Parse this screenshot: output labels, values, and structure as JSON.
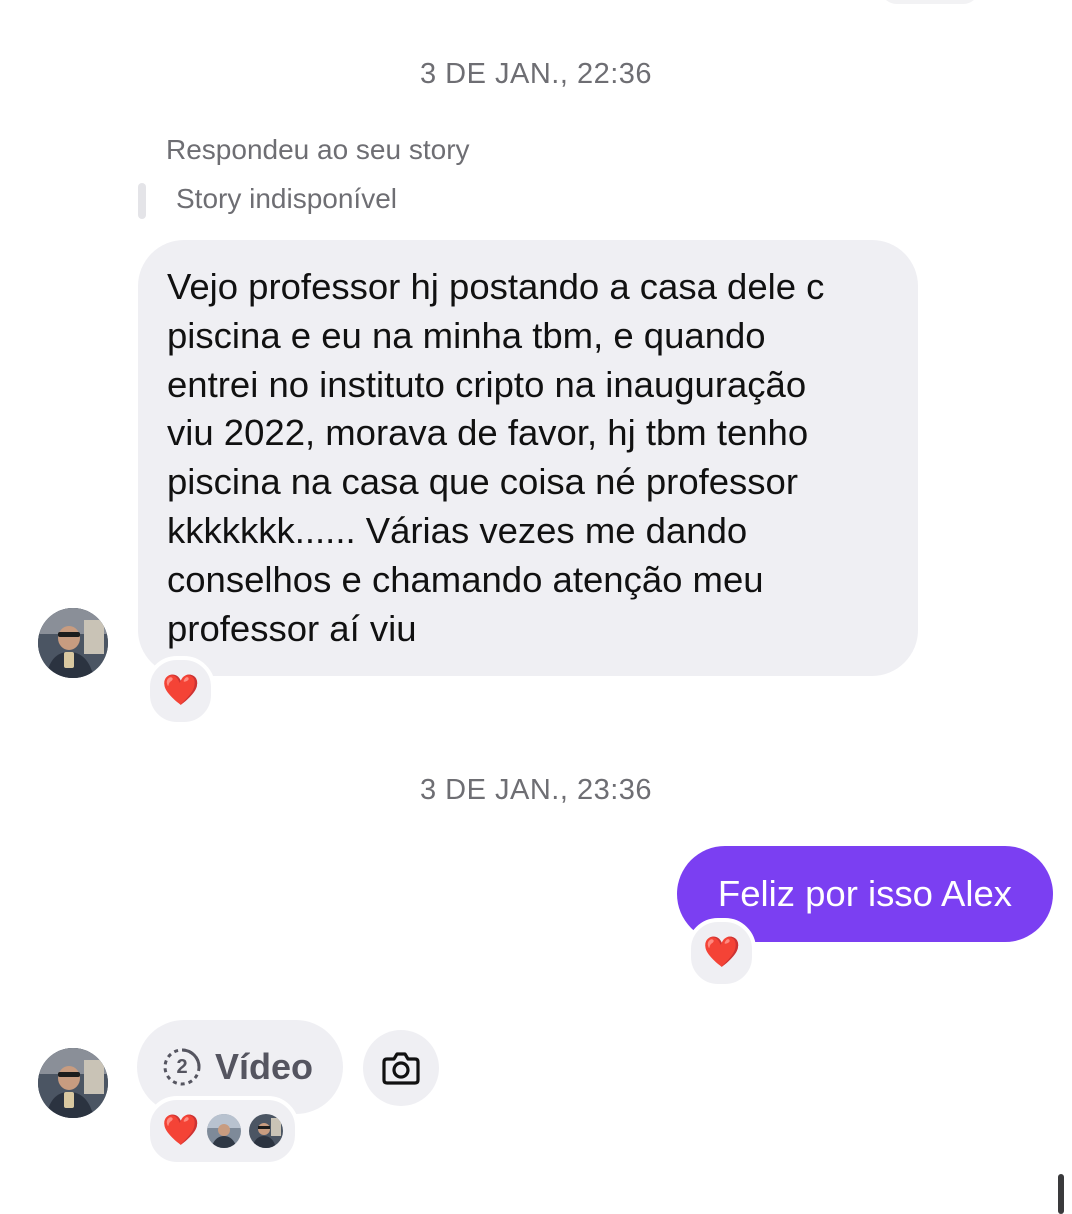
{
  "thread": {
    "timestamp_1": "3 DE JAN., 22:36",
    "story_reply": {
      "label": "Respondeu ao seu story",
      "unavailable": "Story indisponível"
    },
    "incoming_message": {
      "lines": [
        "Vejo professor hj postando a casa dele c",
        "piscina e eu na minha tbm, e quando",
        "entrei no instituto cripto na inauguração",
        "viu 2022, morava de favor, hj tbm tenho",
        "piscina na casa que coisa né professor",
        "kkkkkkk...... Várias vezes me dando",
        "conselhos e chamando atenção meu",
        "professor aí viu"
      ],
      "reaction": "❤️"
    },
    "timestamp_2": "3 DE JAN., 23:36",
    "outgoing_message": {
      "text": "Feliz por isso Alex",
      "reaction": "❤️"
    },
    "video_message": {
      "label": "Vídeo",
      "view_count": "2",
      "reaction": "❤️"
    }
  },
  "colors": {
    "outgoing_bubble": "#7b3ff2",
    "incoming_bubble": "#efeff3",
    "timestamp_text": "#6e6e73"
  },
  "icons": {
    "heart": "heart-emoji-icon",
    "view_once": "view-once-icon",
    "camera": "camera-icon"
  }
}
